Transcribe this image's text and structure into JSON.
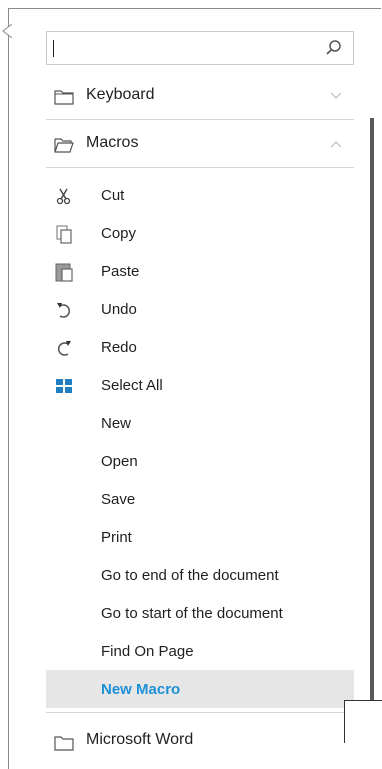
{
  "search": {
    "value": "",
    "placeholder": ""
  },
  "sections": {
    "keyboard": {
      "label": "Keyboard",
      "icon": "folder-icon",
      "expanded": false
    },
    "macros": {
      "label": "Macros",
      "icon": "folder-open-icon",
      "expanded": true
    },
    "microsoft_word": {
      "label": "Microsoft Word",
      "icon": "folder-icon"
    }
  },
  "macro_items": [
    {
      "label": "Cut",
      "icon": "scissors-icon"
    },
    {
      "label": "Copy",
      "icon": "copy-icon"
    },
    {
      "label": "Paste",
      "icon": "paste-icon"
    },
    {
      "label": "Undo",
      "icon": "undo-icon"
    },
    {
      "label": "Redo",
      "icon": "redo-icon"
    },
    {
      "label": "Select All",
      "icon": "select-all-icon"
    },
    {
      "label": "New",
      "icon": ""
    },
    {
      "label": "Open",
      "icon": ""
    },
    {
      "label": "Save",
      "icon": ""
    },
    {
      "label": "Print",
      "icon": ""
    },
    {
      "label": "Go to end of the document",
      "icon": ""
    },
    {
      "label": "Go to start of the document",
      "icon": ""
    },
    {
      "label": "Find On Page",
      "icon": ""
    },
    {
      "label": "New Macro",
      "icon": "",
      "selected": true
    }
  ],
  "colors": {
    "selected_text": "#1e90d6",
    "selected_bg": "#e6e6e6",
    "select_all_icon": "#1f7fc0"
  }
}
